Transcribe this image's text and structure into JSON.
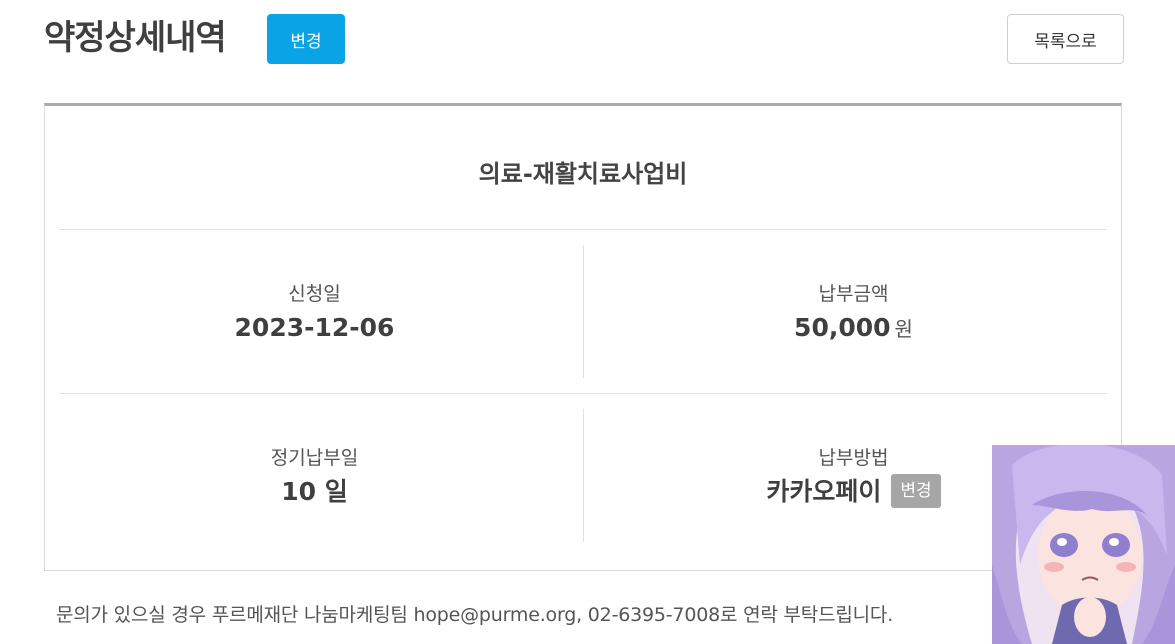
{
  "header": {
    "title": "약정상세내역",
    "change_label": "변경",
    "list_label": "목록으로"
  },
  "pledge": {
    "fund_name": "의료-재활치료사업비",
    "apply_date_label": "신청일",
    "apply_date": "2023-12-06",
    "amount_label": "납부금액",
    "amount": "50,000",
    "amount_unit": "원",
    "payday_label": "정기납부일",
    "payday": "10 일",
    "method_label": "납부방법",
    "method": "카카오페이",
    "method_change_label": "변경"
  },
  "footer": {
    "notice": "문의가 있으실 경우 푸르메재단 나눔마케팅팀 hope@purme.org, 02-6395-7008로 연락 부탁드립니다."
  },
  "colors": {
    "primary": "#0aa3e6",
    "secondary_button": "#a6a6a6",
    "card_top_border": "#aaaaaa"
  }
}
